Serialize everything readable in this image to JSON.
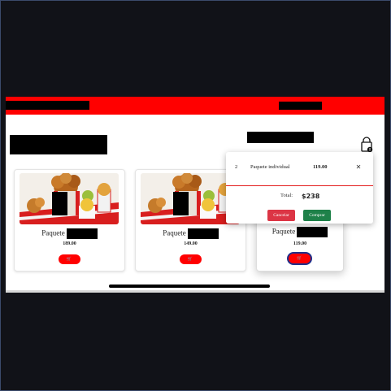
{
  "header": {
    "redacted_brand": "",
    "redacted_nav": ""
  },
  "main": {
    "redacted_heading": "",
    "redacted_user": ""
  },
  "icons": {
    "cart": "shopping-bag-icon",
    "cart_badge": "0",
    "add_to_cart": "cart-icon",
    "close": "close-icon"
  },
  "colors": {
    "brand_red": "#ff0000",
    "cancel": "#dc3545",
    "buy": "#1e8149",
    "divider": "#e31b1b"
  },
  "products": [
    {
      "name": "Paquete",
      "price": "189.00",
      "button": "🛒"
    },
    {
      "name": "Paquete",
      "price": "149.00",
      "button": "🛒"
    },
    {
      "name": "Paquete",
      "price": "119.00",
      "button": "🛒"
    }
  ],
  "cart": {
    "items": [
      {
        "qty": "2",
        "name": "Paquete individual",
        "price": "119.00",
        "remove": "✕"
      }
    ],
    "total_label": "Total:",
    "total_value": "$238",
    "cancel_label": "Cancelar",
    "buy_label": "Comprar"
  }
}
